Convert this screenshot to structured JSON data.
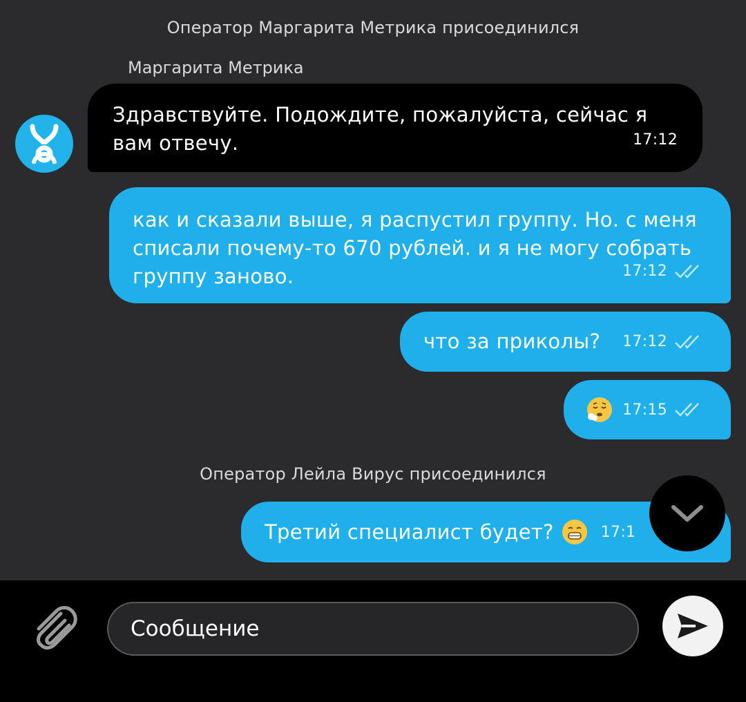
{
  "system_notes": [
    "Оператор Маргарита Метрика присоединился",
    "Оператор Лейла Вирус присоединился"
  ],
  "sender_name": "Маргарита Метрика",
  "messages": [
    {
      "text": "Здравствуйте. Подождите, пожалуйста, сейчас я вам отвечу.",
      "time": "17:12",
      "direction": "incoming"
    },
    {
      "text": "как и сказали выше, я распустил группу. Но. с меня списали почему-то 670 рублей. и я не могу собрать группу заново.",
      "time": "17:12",
      "direction": "outgoing"
    },
    {
      "text": "что за приколы?",
      "time": "17:12",
      "direction": "outgoing"
    },
    {
      "text": "",
      "emoji": "exhaling-face",
      "time": "17:15",
      "direction": "outgoing"
    },
    {
      "text": "Третий специалист будет?",
      "emoji": "grinning-face",
      "time": "17:1",
      "direction": "outgoing"
    }
  ],
  "composer": {
    "placeholder": "Сообщение"
  },
  "icons": {
    "avatar": "yota-logo-icon",
    "attach": "paperclip-icon",
    "send": "send-icon",
    "scroll": "chevron-down-icon",
    "read": "double-check-icon"
  },
  "colors": {
    "background": "#2b2b2d",
    "incoming_bubble": "#000000",
    "outgoing_bubble": "#1fb0ec",
    "accent": "#22b3ea"
  }
}
